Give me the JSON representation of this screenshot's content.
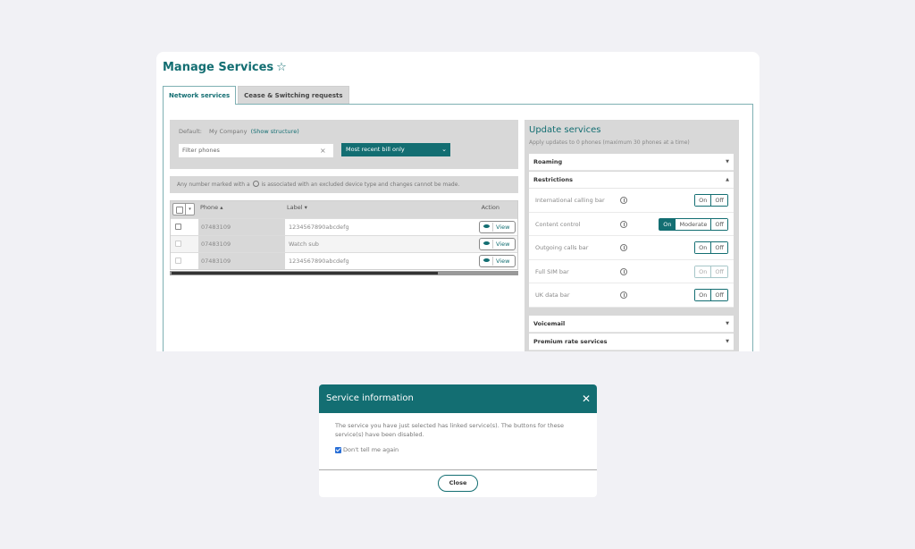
{
  "page": {
    "title": "Manage Services",
    "tabs": [
      {
        "label": "Network services",
        "active": true
      },
      {
        "label": "Cease & Switching requests",
        "active": false
      }
    ]
  },
  "filter": {
    "default_label": "Default:",
    "company": "My Company",
    "show_structure": "(Show structure)",
    "search_placeholder": "Filter phones",
    "clear_icon": "×",
    "bill_select": "Most recent bill only"
  },
  "notice": {
    "before": "Any number marked with a",
    "after": "is associated with an excluded device type and changes cannot be made."
  },
  "table": {
    "headers": {
      "phone": "Phone ▴",
      "label": "Label ▾",
      "action": "Action"
    },
    "rows": [
      {
        "phone": "07483109",
        "label": "1234567890abcdefg",
        "action": "View",
        "disabled": false
      },
      {
        "phone": "07483109",
        "label": "Watch sub",
        "action": "View",
        "disabled": true
      },
      {
        "phone": "07483109",
        "label": "1234567890abcdefg",
        "action": "View",
        "disabled": true
      }
    ]
  },
  "update": {
    "title": "Update services",
    "subtitle": "Apply updates to 0 phones (maximum 30 phones at a time)",
    "sections": {
      "roaming": "Roaming",
      "restrictions": "Restrictions",
      "voicemail": "Voicemail",
      "premium": "Premium rate services"
    },
    "services": [
      {
        "name": "International calling bar",
        "options": [
          "On",
          "Off"
        ],
        "selected": null,
        "disabled": false
      },
      {
        "name": "Content control",
        "options": [
          "On",
          "Moderate",
          "Off"
        ],
        "selected": "On",
        "disabled": false
      },
      {
        "name": "Outgoing calls bar",
        "options": [
          "On",
          "Off"
        ],
        "selected": null,
        "disabled": false
      },
      {
        "name": "Full SIM bar",
        "options": [
          "On",
          "Off"
        ],
        "selected": null,
        "disabled": true
      },
      {
        "name": "UK data bar",
        "options": [
          "On",
          "Off"
        ],
        "selected": null,
        "disabled": false
      }
    ]
  },
  "modal": {
    "title": "Service information",
    "message": "The service you have just selected has linked service(s). The buttons for these service(s) have been disabled.",
    "checkbox_label": "Don't tell me again",
    "checkbox_checked": true,
    "close_label": "Close"
  },
  "colors": {
    "brand": "#136e72",
    "panel": "#d8d8d8",
    "background": "#f1f1f5"
  }
}
